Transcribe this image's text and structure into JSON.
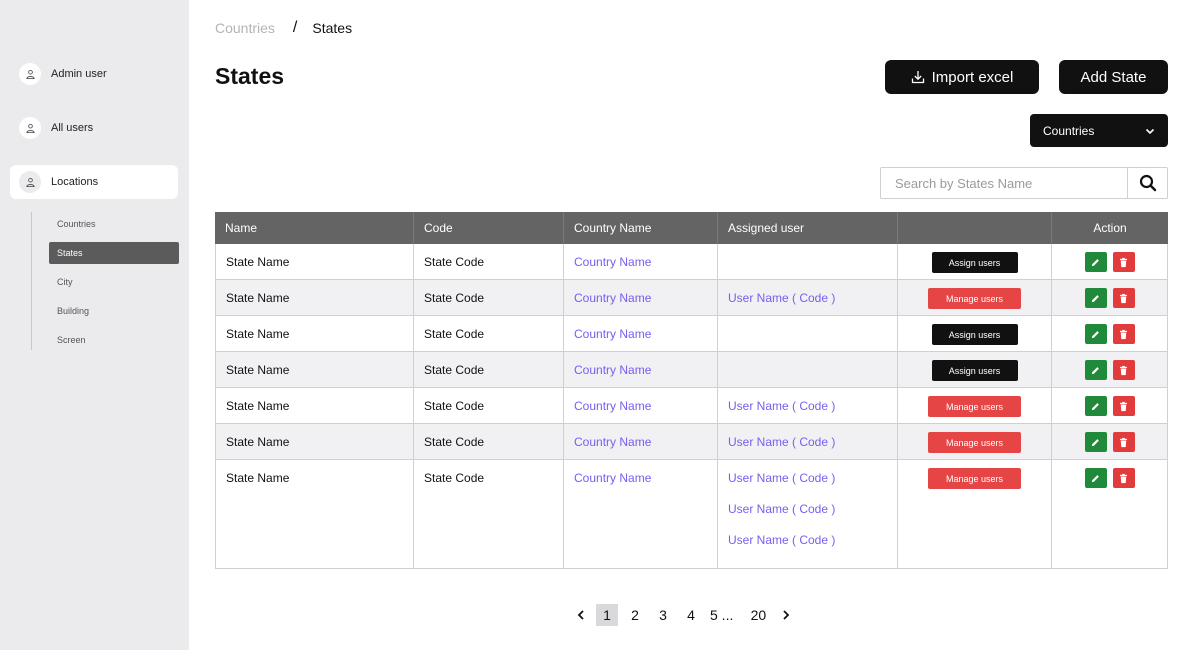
{
  "sidebar": {
    "items": [
      {
        "label": "Admin user",
        "icon": "user-icon"
      },
      {
        "label": "All users",
        "icon": "user-icon"
      },
      {
        "label": "Locations",
        "icon": "user-icon",
        "active": true
      }
    ],
    "subitems": [
      {
        "label": "Countries"
      },
      {
        "label": "States",
        "active": true
      },
      {
        "label": "City"
      },
      {
        "label": "Building"
      },
      {
        "label": "Screen"
      }
    ]
  },
  "breadcrumb": {
    "parent": "Countries",
    "separator": "/",
    "current": "States"
  },
  "page": {
    "title": "States"
  },
  "toolbar": {
    "import_label": "Import excel",
    "add_label": "Add State",
    "filter_value": "Countries"
  },
  "search": {
    "placeholder": "Search by States Name"
  },
  "table": {
    "headers": [
      "Name",
      "Code",
      "Country Name",
      "Assigned user",
      "",
      "Action"
    ],
    "rows": [
      {
        "name": "State Name",
        "code": "State Code",
        "country": "Country Name",
        "users": [],
        "button": "Assign users"
      },
      {
        "name": "State Name",
        "code": "State Code",
        "country": "Country Name",
        "users": [
          "User Name ( Code )"
        ],
        "button": "Manage users"
      },
      {
        "name": "State Name",
        "code": "State Code",
        "country": "Country Name",
        "users": [],
        "button": "Assign users"
      },
      {
        "name": "State Name",
        "code": "State Code",
        "country": "Country Name",
        "users": [],
        "button": "Assign users"
      },
      {
        "name": "State Name",
        "code": "State Code",
        "country": "Country Name",
        "users": [
          "User Name ( Code )"
        ],
        "button": "Manage users"
      },
      {
        "name": "State Name",
        "code": "State Code",
        "country": "Country Name",
        "users": [
          "User Name ( Code )"
        ],
        "button": "Manage users"
      },
      {
        "name": "State Name",
        "code": "State Code",
        "country": "Country Name",
        "users": [
          "User Name ( Code )",
          "User Name ( Code )",
          "User Name ( Code )"
        ],
        "button": "Manage users"
      }
    ]
  },
  "pagination": {
    "pages": [
      "1",
      "2",
      "3",
      "4",
      "5 ...",
      "20"
    ],
    "current": "1"
  },
  "colors": {
    "accent_link": "#7b5cf0",
    "manage_red": "#e54545",
    "edit_green": "#1f8a3a",
    "header_gray": "#646464",
    "sidebar_bg": "#ebebee"
  }
}
